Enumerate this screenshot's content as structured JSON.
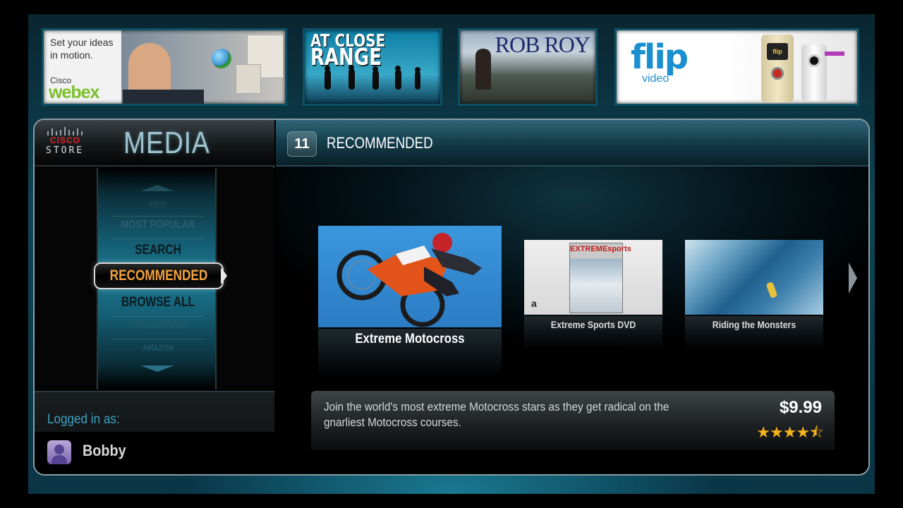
{
  "banners": {
    "webex": {
      "tagline": "Set your ideas in motion.",
      "brand_top": "Cisco",
      "brand": "webex"
    },
    "at_close_range": {
      "line1": "AT CLOSE",
      "line2": "RANGE"
    },
    "rob_roy": {
      "title": "ROB ROY"
    },
    "flip": {
      "logo": "flip",
      "sub": "video",
      "screen_logo": "flip"
    }
  },
  "store": {
    "logo_word": "CISCO",
    "logo_sub": "STORE",
    "section_title": "MEDIA"
  },
  "menu": {
    "items": [
      "NEW",
      "MOST POPULAR",
      "SEARCH",
      "RECOMMENDED",
      "BROWSE ALL",
      "ON DEMAND",
      "AMAZON"
    ],
    "selected": "RECOMMENDED"
  },
  "login": {
    "label": "Logged in as:",
    "user": "Bobby"
  },
  "content": {
    "count": "11",
    "heading": "RECOMMENDED",
    "cards": [
      {
        "title": "Extreme Motocross"
      },
      {
        "title": "Extreme Sports DVD",
        "cover_text": "EXTREMEsports",
        "store_mark": "a"
      },
      {
        "title": "Riding the Monsters"
      }
    ],
    "detail": {
      "description": "Join the world's most extreme Motocross stars as they get radical on the gnarliest Motocross courses.",
      "price": "$9.99",
      "rating": "★★★★⯪"
    }
  },
  "colors": {
    "accent": "#3aa3c3",
    "selected_menu_text": "#f3a23c",
    "star": "#f5b21b",
    "cisco_red": "#e1232a"
  }
}
